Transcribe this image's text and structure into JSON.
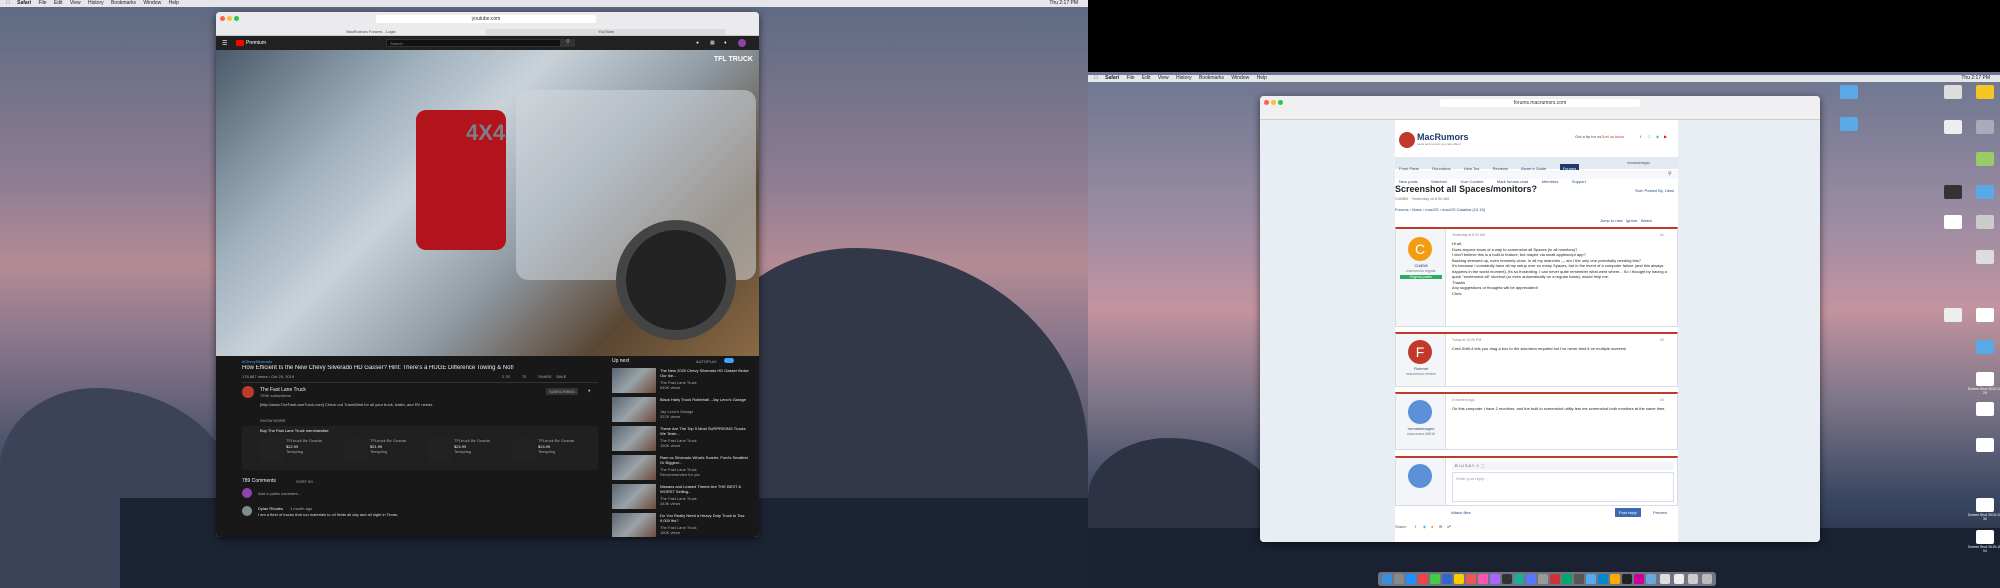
{
  "menubar1": {
    "apple": "",
    "app": "Safari",
    "items": [
      "File",
      "Edit",
      "View",
      "History",
      "Bookmarks",
      "Window",
      "Help"
    ],
    "clock": "Thu 2:17 PM"
  },
  "menubar2": {
    "app": "Safari",
    "items": [
      "File",
      "Edit",
      "View",
      "History",
      "Bookmarks",
      "Window",
      "Help"
    ],
    "clock": "Thu 2:17 PM"
  },
  "youtube_window": {
    "url": "youtube.com",
    "tab_left": "MacRumors Forums - Login",
    "tab_right": "YouTube",
    "logo": "Premium",
    "search_placeholder": "Search",
    "brand_overlay": "TFL TRUCK",
    "hashtag": "#ChevySilverado",
    "video_title": "How Efficient Is the New Chevy Silverado HD Gasser? Hint: There's a HUGE Difference Towing & Not!",
    "views": "178,887 views • Oct 29, 2019",
    "likes": "2.7K",
    "dislikes": "75",
    "share": "SHARE",
    "save": "SAVE",
    "channel": "The Fast Lane Truck",
    "subs": "759K subscribers",
    "subscribe": "SUBSCRIBED",
    "desc": "[http://www.TheFastLaneTruck.com] Check out TransWest for all your truck, trailer, and RV needs.",
    "show_more": "SHOW MORE",
    "merch_title": "Buy The Fast Lane Truck merchandise",
    "merch": [
      {
        "name": "TFLtruck Be Guarded Short",
        "price": "$22.99",
        "store": "Teespring"
      },
      {
        "name": "TFLtruck Be Guarded Short",
        "price": "$21.99",
        "store": "Teespring"
      },
      {
        "name": "TFLtruck Be Guarded Short",
        "price": "$24.99",
        "store": "Teespring"
      },
      {
        "name": "TFLtruck Be Guarded Short",
        "price": "$24.99",
        "store": "Teespring"
      }
    ],
    "comments_count": "789 Comments",
    "sort": "SORT BY",
    "add_comment": "Add a public comment...",
    "comment_author": "Dylan Rhodes",
    "comment_age": "1 month ago",
    "comment_text": "I am a fleet of trucks that run materials to oil fields all day and all night in Texas.",
    "up_next": "Up next",
    "autoplay": "AUTOPLAY",
    "recs": [
      {
        "title": "The New 2020 Chevy Silverado HD Gasser Broke Our Ike...",
        "channel": "The Fast Lane Truck",
        "views": "540K views"
      },
      {
        "title": "Black Hairy Truck Rollerball - Jay Leno's Garage",
        "channel": "Jay Leno's Garage",
        "views": "337K views"
      },
      {
        "title": "These Are The Top 5 Most SURPRISING Trucks We Teste...",
        "channel": "The Fast Lane Truck",
        "views": "150K views"
      },
      {
        "title": "Ram vs Silverado What's Scarier, Ford's Smallest Or Biggest...",
        "channel": "The Fast Lane Truck",
        "views": "Recommended for you"
      },
      {
        "title": "Nissans and Leased Theme Are THE BEST & WORST Selling...",
        "channel": "The Fast Lane Truck",
        "views": "343K views"
      },
      {
        "title": "Do You Really Need a Heavy Duty Truck to Tow 9,000 lbs?",
        "channel": "The Fast Lane Truck",
        "views": "150K views"
      }
    ]
  },
  "macrumors_window": {
    "url": "forums.macrumors.com",
    "logo": "MacRumors",
    "tagline": "news and rumors you care about",
    "tip": "Got a tip for us?",
    "tip_link": "Let us know",
    "nav": [
      "Front Page",
      "Roundups",
      "How Tos",
      "Reviews",
      "Buyer's Guide",
      "Forums"
    ],
    "user": "mrmashmageo",
    "subnav": [
      "New posts",
      "Watched",
      "Your Content",
      "Mark forums read",
      "Members",
      "Support"
    ],
    "thread_title": "Screenshot all Spaces/monitors?",
    "thread_meta": "ChiliBill · Yesterday at 8:30 AM",
    "sort": "Sort: Posted By, Likes",
    "crumbs": [
      "Forums",
      "Macs",
      "macOS",
      "macOS Catalina (10.15)"
    ],
    "thread_tools": [
      "Jump to new",
      "Ignore",
      "Watch"
    ],
    "posts": [
      {
        "avatar": "C",
        "color": "#f39c12",
        "user": "ChiliBill",
        "role": "macrumors regular",
        "badge": "Original poster",
        "date": "Yesterday at 8:30 AM",
        "num": "#1",
        "body": [
          "Hi all,",
          "Does anyone know of a way to screenshot all Spaces (in all monitors)?",
          "I don't believe this is a built-in feature, but maybe via small applescript app?",
          "",
          "Backing stressed up, even remotely close, in all my searches — am I the only one potentially needing this?",
          "It's because I constantly have all my setup over so many Spaces, but in the event of a computer failure (and this always happens in the worst moment), it's so frustrating. I can never quite remember what went where... So I thought by having a quick \"screenshot all\" shortcut (or even automatically on a regular basis), would help me.",
          "Thanks",
          "Any suggestions or thoughts will be appreciated!",
          "",
          "Chris"
        ]
      },
      {
        "avatar": "F",
        "color": "#c0392b",
        "user": "Fishrnet",
        "role": "macrumors newbie",
        "badge": "",
        "date": "Today at 12:06 PM",
        "num": "#2",
        "body": [
          "Cmd-Shift-4 lets you drag a box to the size/area required but I've never tried it on multiple screens!"
        ]
      },
      {
        "avatar": "",
        "color": "#5b8fd6",
        "user": "mrmashmageo",
        "role": "macrumors 65816",
        "badge": "",
        "date": "A moment ago",
        "num": "#3",
        "body": [
          "On this computer I have 2 monitors, and the built-in screenshot utility lets me screenshot both monitors at the same time."
        ]
      }
    ],
    "reply_placeholder": "Write your reply...",
    "attach": "Attach files",
    "post_reply": "Post reply",
    "preview": "Preview",
    "share_label": "Share:"
  },
  "desktop_icons": [
    "Screen Shot 2019-10-29",
    "Screen Shot 2019-10-30",
    "Screen Shot 2019-11-04"
  ]
}
